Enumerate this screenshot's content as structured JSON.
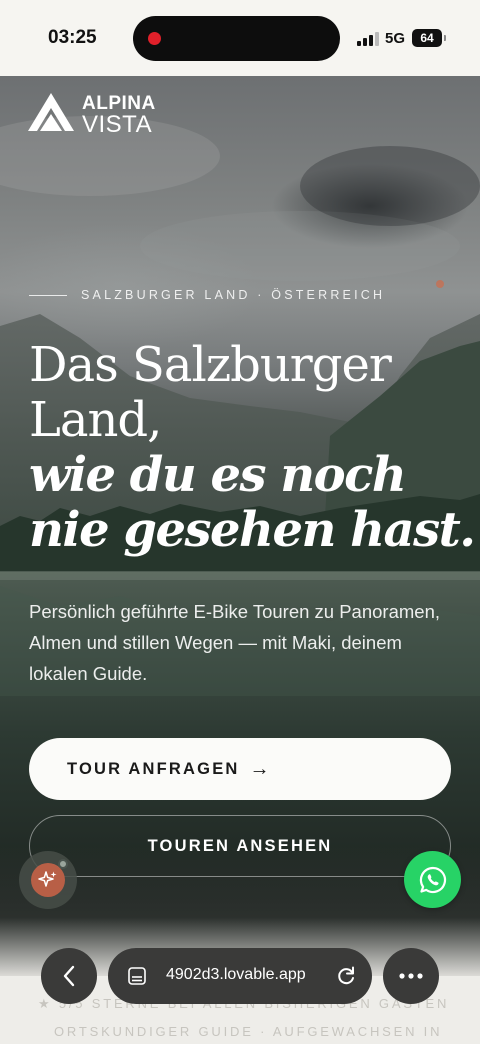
{
  "status_bar": {
    "time": "03:25",
    "network": "5G",
    "battery": "64"
  },
  "hero": {
    "logo": {
      "line1": "ALPINA",
      "line2": "VISTA"
    },
    "eyebrow": "SALZBURGER LAND · ÖSTERREICH",
    "headline": {
      "line1": "Das Salzburger",
      "line2": "Land,",
      "line3": "wie du es noch",
      "line4": "nie gesehen hast."
    },
    "lead": "Persönlich geführte E-Bike Touren zu Panoramen, Almen und stillen Wegen — mit Maki, deinem lokalen Guide.",
    "primary_button": {
      "label": "TOUR ANFRAGEN",
      "arrow": "→"
    },
    "secondary_button": {
      "label": "TOUREN ANSEHEN"
    }
  },
  "below_fold": {
    "line1": "★  5/5 STERNE BEI ALLEN BISHERIGEN GÄSTEN",
    "line2": "ORTSKUNDIGER GUIDE · AUFGEWACHSEN IN"
  },
  "browser": {
    "url": "4902d3.lovable.app"
  },
  "icons": {
    "ai_fab": "sparkle-icon",
    "whatsapp_fab": "whatsapp-icon",
    "back": "chevron-left-icon",
    "reader": "page-icon",
    "reload": "reload-icon",
    "more": "more-icon"
  },
  "colors": {
    "whatsapp": "#27d366",
    "ai_fab": "#b85f46",
    "record_dot": "#e0202a",
    "primary_button_bg": "#fbfbf9"
  }
}
